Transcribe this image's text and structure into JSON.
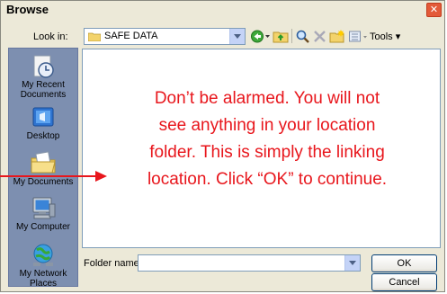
{
  "window": {
    "title": "Browse"
  },
  "toolbar": {
    "look_in_label": "Look in:",
    "look_in_value": "SAFE DATA",
    "tools_label": "Tools ▾"
  },
  "places": [
    {
      "label": "My Recent Documents",
      "icon": "recent-documents-icon"
    },
    {
      "label": "Desktop",
      "icon": "desktop-icon"
    },
    {
      "label": "My Documents",
      "icon": "my-documents-icon"
    },
    {
      "label": "My Computer",
      "icon": "my-computer-icon"
    },
    {
      "label": "My Network Places",
      "icon": "network-places-icon"
    }
  ],
  "annotation": {
    "lines": [
      "Don’t be alarmed.  You will not",
      "see anything in your location",
      "folder.  This is simply the linking",
      "location.  Click “OK” to continue."
    ],
    "color": "#e8161c"
  },
  "footer": {
    "folder_name_label": "Folder name:",
    "folder_name_value": "",
    "ok_label": "OK",
    "cancel_label": "Cancel"
  }
}
